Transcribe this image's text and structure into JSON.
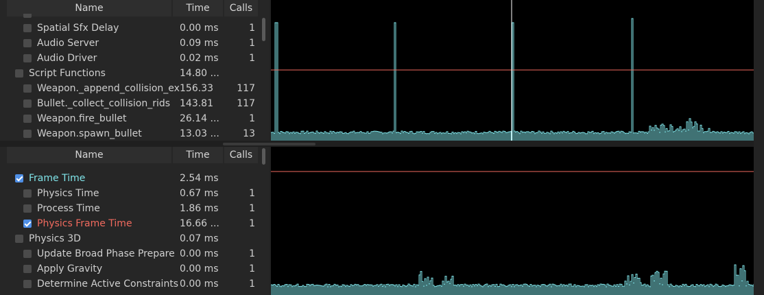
{
  "columns": {
    "name": "Name",
    "time": "Time",
    "calls": "Calls"
  },
  "colors": {
    "graph_line": "#7fe3e8",
    "frame_time": "#7fe3e8",
    "physics_frame_time": "#f06a5e",
    "limit_line": "#f06a5e",
    "checkbox_on": "#4f8fe6"
  },
  "top_rows": [
    {
      "name": "Spatial Sfx Delay",
      "time": "0.00 ms",
      "calls": "1",
      "indent": 1,
      "checked": false
    },
    {
      "name": "Audio Server",
      "time": "0.09 ms",
      "calls": "1",
      "indent": 1,
      "checked": false
    },
    {
      "name": "Audio Driver",
      "time": "0.02 ms",
      "calls": "1",
      "indent": 1,
      "checked": false
    },
    {
      "name": "Script Functions",
      "time": "14.80 ...",
      "calls": "",
      "indent": 0,
      "checked": false
    },
    {
      "name": "Weapon._append_collision_ex...",
      "time": "156.33",
      "calls": "117",
      "indent": 1,
      "checked": false
    },
    {
      "name": "Bullet._collect_collision_rids",
      "time": "143.81",
      "calls": "117",
      "indent": 1,
      "checked": false
    },
    {
      "name": "Weapon.fire_bullet",
      "time": "26.14 ...",
      "calls": "1",
      "indent": 1,
      "checked": false
    },
    {
      "name": "Weapon.spawn_bullet",
      "time": "13.03 ...",
      "calls": "13",
      "indent": 1,
      "checked": false
    }
  ],
  "bottom_rows": [
    {
      "name": "Frame Time",
      "time": "2.54 ms",
      "calls": "",
      "indent": 0,
      "checked": true,
      "color": "#7fe3e8"
    },
    {
      "name": "Physics Time",
      "time": "0.67 ms",
      "calls": "1",
      "indent": 1,
      "checked": false
    },
    {
      "name": "Process Time",
      "time": "1.86 ms",
      "calls": "1",
      "indent": 1,
      "checked": false
    },
    {
      "name": "Physics Frame Time",
      "time": "16.66 ...",
      "calls": "1",
      "indent": 1,
      "checked": true,
      "color": "#f06a5e"
    },
    {
      "name": "Physics 3D",
      "time": "0.07 ms",
      "calls": "",
      "indent": 0,
      "checked": false
    },
    {
      "name": "Update Broad Phase Prepare",
      "time": "0.00 ms",
      "calls": "1",
      "indent": 1,
      "checked": false
    },
    {
      "name": "Apply Gravity",
      "time": "0.00 ms",
      "calls": "1",
      "indent": 1,
      "checked": false
    },
    {
      "name": "Determine Active Constraints",
      "time": "0.00 ms",
      "calls": "1",
      "indent": 1,
      "checked": false
    }
  ]
}
